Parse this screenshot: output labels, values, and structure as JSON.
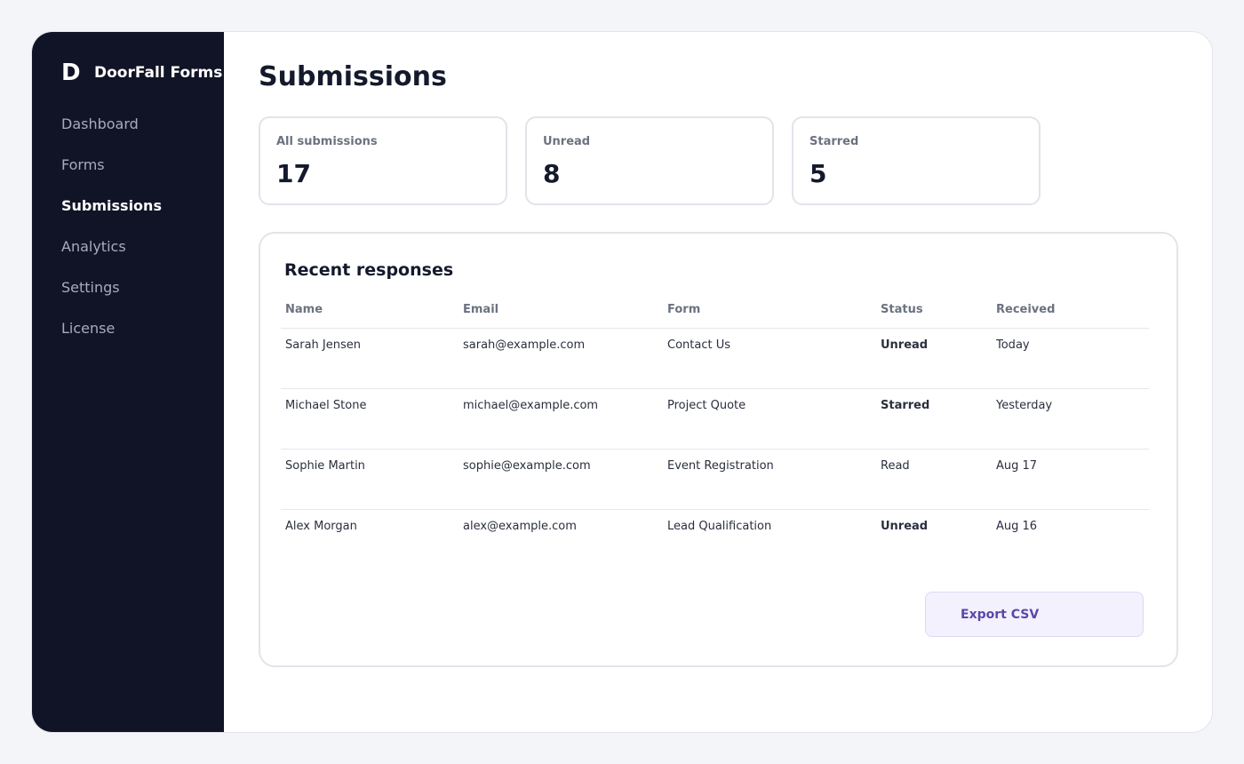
{
  "sidebar": {
    "brand_mark": "D",
    "brand_name": "DoorFall Forms",
    "items": [
      {
        "label": "Dashboard",
        "active": false
      },
      {
        "label": "Forms",
        "active": false
      },
      {
        "label": "Submissions",
        "active": true
      },
      {
        "label": "Analytics",
        "active": false
      },
      {
        "label": "Settings",
        "active": false
      },
      {
        "label": "License",
        "active": false
      }
    ]
  },
  "main": {
    "title": "Submissions",
    "stats": [
      {
        "label": "All submissions",
        "value": "17"
      },
      {
        "label": "Unread",
        "value": "8"
      },
      {
        "label": "Starred",
        "value": "5"
      }
    ],
    "panel": {
      "title": "Recent responses",
      "columns": [
        "Name",
        "Email",
        "Form",
        "Status",
        "Received"
      ],
      "rows": [
        [
          "Sarah Jensen",
          "sarah@example.com",
          "Contact Us",
          "Unread",
          "Today"
        ],
        [
          "Michael Stone",
          "michael@example.com",
          "Project Quote",
          "Starred",
          "Yesterday"
        ],
        [
          "Sophie Martin",
          "sophie@example.com",
          "Event Registration",
          "Read",
          "Aug 17"
        ],
        [
          "Alex Morgan",
          "alex@example.com",
          "Lead Qualification",
          "Unread",
          "Aug 16"
        ]
      ],
      "export_label": "Export CSV"
    }
  },
  "colors": {
    "sidebar_bg": "#111426",
    "accent": "#5b47a8",
    "accent_bg": "#f3f1fd"
  }
}
